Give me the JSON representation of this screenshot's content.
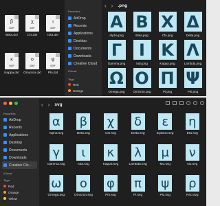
{
  "left_window": {
    "files": [
      {
        "name": "Beta.dxf",
        "badge": "DXF",
        "mark": "β"
      },
      {
        "name": "Chi.dxf",
        "badge": "DXF",
        "mark": "χ"
      },
      {
        "name": "Iota.dxf",
        "badge": "DXF",
        "mark": "ι"
      },
      {
        "name": "Kappa.dxf",
        "badge": "DXF",
        "mark": "κ"
      },
      {
        "name": "Omicron.dxf",
        "badge": "DXF",
        "mark": "ο"
      },
      {
        "name": "Phi.dxf",
        "badge": "DXF",
        "mark": "φ"
      }
    ]
  },
  "png_window": {
    "title": ".png",
    "sidebar": {
      "favorites_heading": "Favorites",
      "items": [
        {
          "label": "AirDrop",
          "icon": "airdrop-icon",
          "color": "#3a8ff0"
        },
        {
          "label": "Recents",
          "icon": "clock-icon",
          "color": "#3a8ff0"
        },
        {
          "label": "Applications",
          "icon": "applications-icon",
          "color": "#3a8ff0"
        },
        {
          "label": "Desktop",
          "icon": "desktop-icon",
          "color": "#3a8ff0"
        },
        {
          "label": "Documents",
          "icon": "document-icon",
          "color": "#3a8ff0"
        },
        {
          "label": "Downloads",
          "icon": "download-icon",
          "color": "#3a8ff0"
        },
        {
          "label": "Creative Cloud",
          "icon": "creative-cloud-icon",
          "color": "#3a8ff0"
        }
      ],
      "icloud_heading": "iCloud",
      "tags_heading": "Tags",
      "tags": [
        {
          "label": "Red",
          "color": "#ff453a"
        },
        {
          "label": "Orange",
          "color": "#ff9f0a"
        }
      ]
    },
    "files": [
      {
        "glyph": "Α",
        "name": "Alpha.png"
      },
      {
        "glyph": "Β",
        "name": "Beta.png"
      },
      {
        "glyph": "Χ",
        "name": "Chi.png"
      },
      {
        "glyph": "Δ",
        "name": "Delta.png"
      },
      {
        "glyph": "Γ",
        "name": "Gamma.png"
      },
      {
        "glyph": "Ι",
        "name": "Iota.png"
      },
      {
        "glyph": "Κ",
        "name": "Kappa.png"
      },
      {
        "glyph": "Λ",
        "name": "Lambda.png"
      },
      {
        "glyph": "Ω",
        "name": "Omega.png"
      },
      {
        "glyph": "Ο",
        "name": "Omicron.png"
      },
      {
        "glyph": "Π",
        "name": "Pi.png"
      },
      {
        "glyph": "Ψ",
        "name": "Psi.png"
      }
    ]
  },
  "svg_window": {
    "title": "svg",
    "sidebar": {
      "favorites_heading": "Favorites",
      "items": [
        {
          "label": "AirDrop",
          "icon": "airdrop-icon",
          "color": "#3a8ff0"
        },
        {
          "label": "Recents",
          "icon": "clock-icon",
          "color": "#3a8ff0"
        },
        {
          "label": "Applications",
          "icon": "applications-icon",
          "color": "#3a8ff0"
        },
        {
          "label": "Desktop",
          "icon": "desktop-icon",
          "color": "#3a8ff0"
        },
        {
          "label": "Documents",
          "icon": "document-icon",
          "color": "#3a8ff0"
        },
        {
          "label": "Downloads",
          "icon": "download-icon",
          "color": "#3a8ff0"
        },
        {
          "label": "Creative Clo...",
          "icon": "creative-cloud-icon",
          "color": "#3a8ff0"
        }
      ],
      "icloud_heading": "iCloud",
      "tags_heading": "Tags",
      "tags": [
        {
          "label": "Red",
          "color": "#ff453a"
        },
        {
          "label": "Orange",
          "color": "#ff9f0a"
        },
        {
          "label": "Yellow",
          "color": "#ffd60a"
        }
      ]
    },
    "files": [
      {
        "glyph": "α",
        "name": "Alpha.svg"
      },
      {
        "glyph": "β",
        "name": "Beta.svg"
      },
      {
        "glyph": "χ",
        "name": "Chi.svg"
      },
      {
        "glyph": "δ",
        "name": "Delta.svg"
      },
      {
        "glyph": "ε",
        "name": "Epsilon.svg"
      },
      {
        "glyph": "η",
        "name": "Eta.svg"
      },
      {
        "glyph": "γ",
        "name": "Gamma.svg"
      },
      {
        "glyph": "ι",
        "name": "Iota.svg"
      },
      {
        "glyph": "κ",
        "name": "Kappa.svg"
      },
      {
        "glyph": "λ",
        "name": "Lambda.svg"
      },
      {
        "glyph": "μ",
        "name": "Mu.svg"
      },
      {
        "glyph": "ν",
        "name": "Nu.svg"
      },
      {
        "glyph": "ω",
        "name": "Omega.svg"
      },
      {
        "glyph": "ο",
        "name": "Omicron.svg"
      },
      {
        "glyph": "φ",
        "name": "Phi.svg"
      },
      {
        "glyph": "π",
        "name": "Pi.svg"
      },
      {
        "glyph": "ψ",
        "name": "Psi.svg"
      },
      {
        "glyph": "ρ",
        "name": "Rho.svg"
      }
    ]
  },
  "colors": {
    "tile": "#bfe7f4",
    "glyph": "#16475a"
  }
}
